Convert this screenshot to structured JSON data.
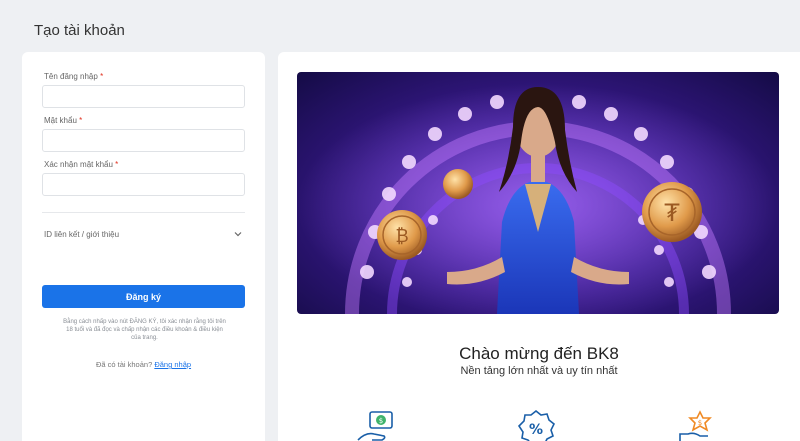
{
  "page": {
    "title": "Tạo tài khoản"
  },
  "form": {
    "username_label": "Tên đăng nhập",
    "password_label": "Mật khẩu",
    "confirm_label": "Xác nhận mật khẩu",
    "required_mark": "*",
    "referral_label": "ID liên kết / giới thiệu",
    "submit_label": "Đăng ký",
    "terms_text": "Bằng cách nhấp vào nút ĐĂNG KÝ, tôi xác nhận rằng tôi trên 18 tuổi và đã đọc và chấp nhận các điều khoản & điều kiện của trang.",
    "login_prompt": "Đã có tài khoản?",
    "login_link": "Đăng nhập"
  },
  "promo": {
    "welcome_title": "Chào mừng đến BK8",
    "welcome_subtitle": "Nền tảng lớn nhất và uy tín nhất"
  },
  "icons": [
    "chevron-down-icon",
    "money-hand-icon",
    "percent-badge-icon",
    "dollar-star-hand-icon"
  ],
  "colors": {
    "accent": "#1a73e8",
    "required": "#e0301e",
    "banner_purple": "#3a1a8f",
    "icon_blue": "#1a5fa8",
    "icon_green": "#3fb36b",
    "icon_orange": "#f08a24"
  }
}
